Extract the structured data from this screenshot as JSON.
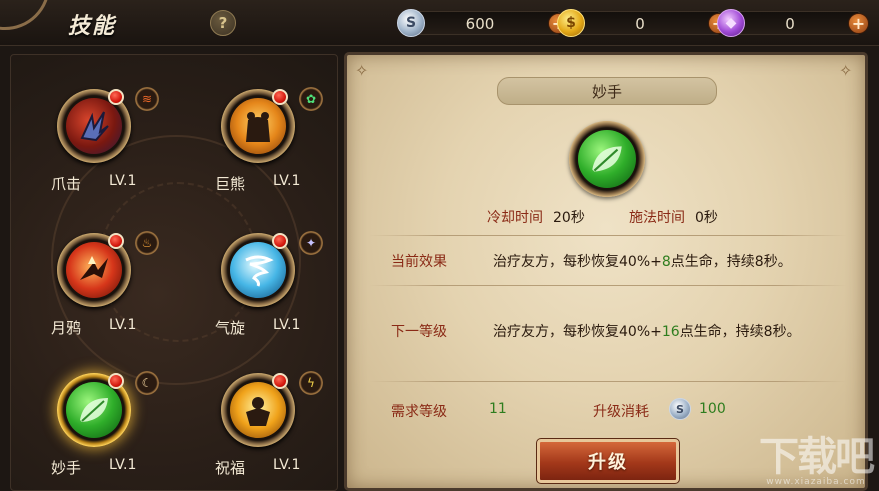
{
  "header": {
    "title": "技能",
    "help_label": "?",
    "currencies": [
      {
        "name": "silver-coin",
        "icon": "silver-coin-icon",
        "symbol": "S",
        "value": "600",
        "plus": "+"
      },
      {
        "name": "gold-coin",
        "icon": "gold-coin-icon",
        "symbol": "$",
        "value": "0",
        "plus": "+"
      },
      {
        "name": "gem",
        "icon": "purple-gem-icon",
        "symbol": "◆",
        "value": "0",
        "plus": "+"
      }
    ]
  },
  "skills": [
    {
      "name": "爪击",
      "level": "LV.1",
      "icon": "claw-strike-icon"
    },
    {
      "name": "巨熊",
      "level": "LV.1",
      "icon": "great-bear-icon"
    },
    {
      "name": "月鸦",
      "level": "LV.1",
      "icon": "moon-crow-icon"
    },
    {
      "name": "气旋",
      "level": "LV.1",
      "icon": "cyclone-icon"
    },
    {
      "name": "妙手",
      "level": "LV.1",
      "icon": "leaf-heal-icon",
      "selected": true
    },
    {
      "name": "祝福",
      "level": "LV.1",
      "icon": "blessing-icon"
    }
  ],
  "detail": {
    "title": "妙手",
    "icon": "leaf-heal-icon",
    "cooldown_label": "冷却时间",
    "cooldown_value": "20秒",
    "cast_label": "施法时间",
    "cast_value": "0秒",
    "current_label": "当前效果",
    "current_text_a": "治疗友方，每秒恢复40%+",
    "current_text_b": "8",
    "current_text_c": "点生命，持续8秒。",
    "next_label": "下一等级",
    "next_text_a": "治疗友方，每秒恢复40%+",
    "next_text_b": "16",
    "next_text_c": "点生命，持续8秒。",
    "req_level_label": "需求等级",
    "req_level_value": "11",
    "cost_label": "升级消耗",
    "cost_value": "100",
    "upgrade_label": "升级"
  },
  "watermark": {
    "big": "下载吧",
    "small": "www.xiazaiba.com"
  },
  "colors": {
    "accent_red": "#8a2a16",
    "value_green": "#2e7d1e",
    "button_orange": "#a3381a",
    "selected_gold": "#ffd35a"
  }
}
